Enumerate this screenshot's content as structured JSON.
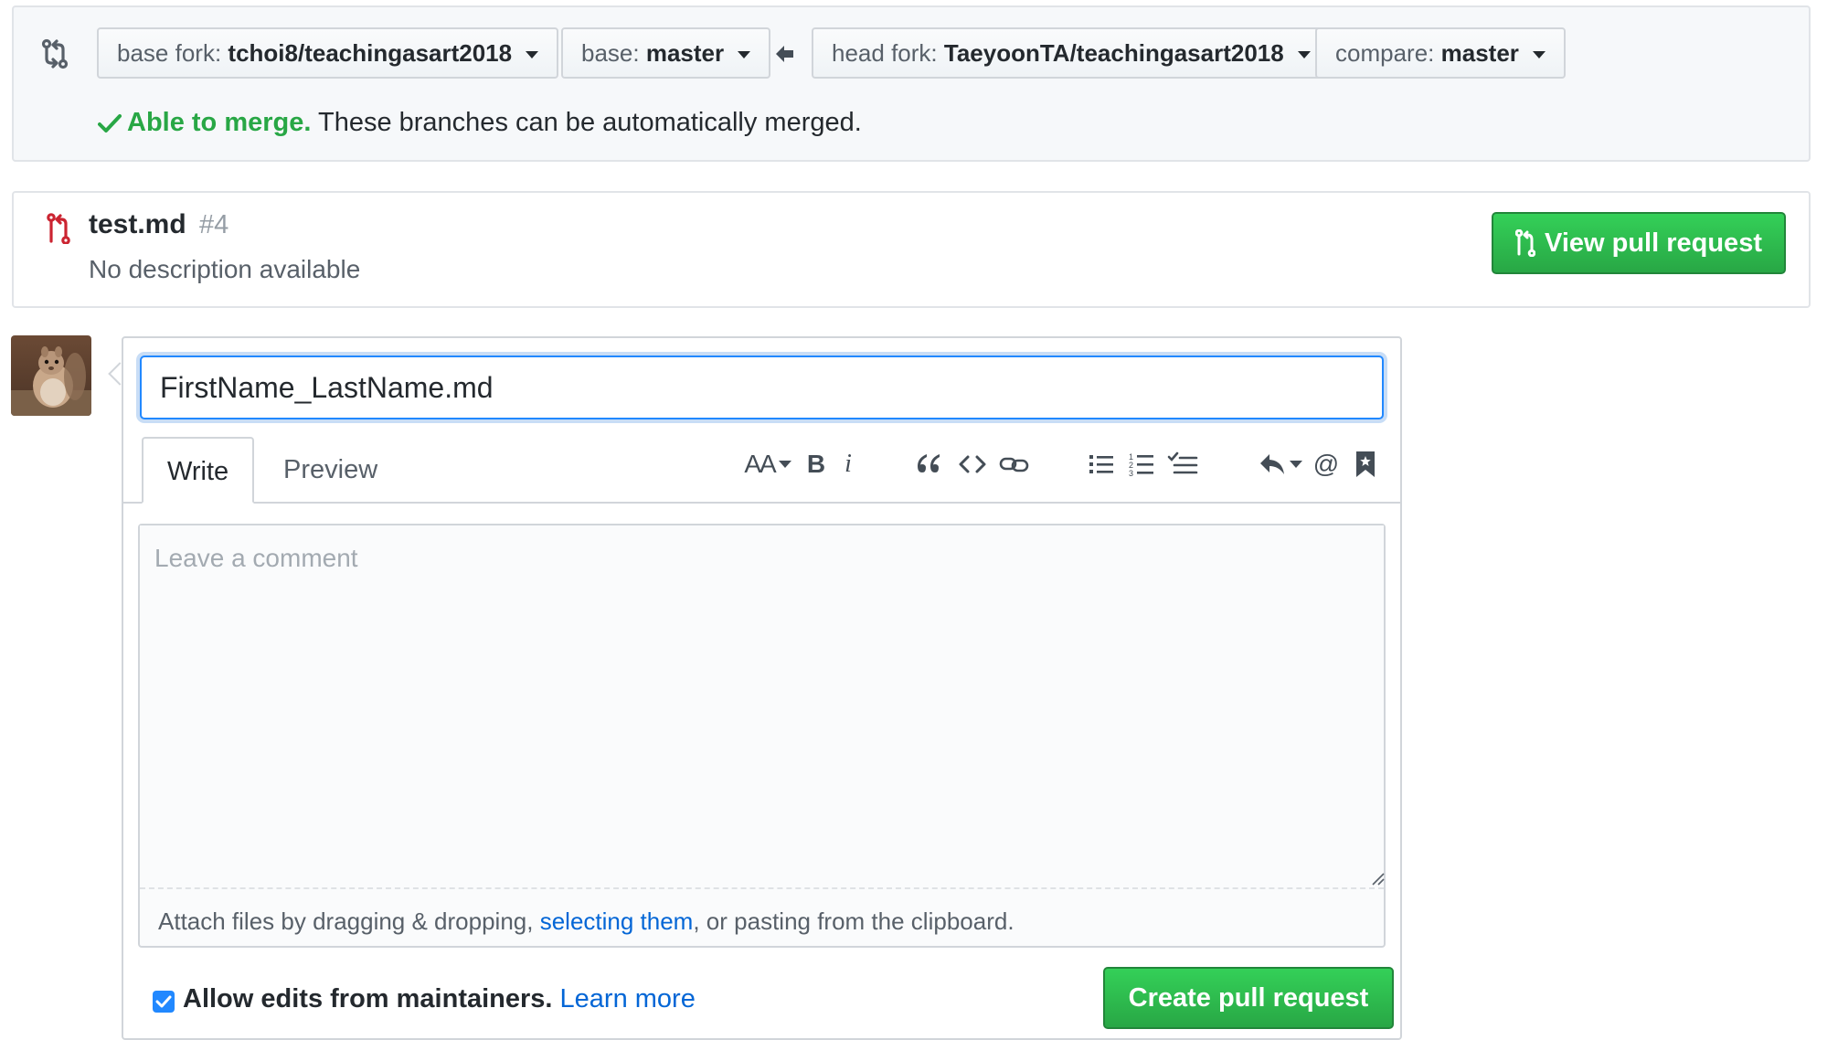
{
  "compare": {
    "base_fork_label": "base fork:",
    "base_fork_value": "tchoi8/teachingasart2018",
    "base_label": "base:",
    "base_value": "master",
    "head_fork_label": "head fork:",
    "head_fork_value": "TaeyoonTA/teachingasart2018",
    "compare_label": "compare:",
    "compare_value": "master",
    "merge_ok": "Able to merge.",
    "merge_text": "These branches can be automatically merged."
  },
  "existing_pr": {
    "title": "test.md",
    "number": "#4",
    "description": "No description available",
    "view_button": "View pull request"
  },
  "form": {
    "title_value": "FirstName_LastName.md",
    "tabs": [
      "Write",
      "Preview"
    ],
    "toolbar": {
      "header": "AA",
      "bold": "B",
      "italic": "i",
      "mention": "@"
    },
    "comment_placeholder": "Leave a comment",
    "attach_prefix": "Attach files by dragging & dropping, ",
    "attach_link": "selecting them",
    "attach_suffix": ", or pasting from the clipboard.",
    "maintainers_label": "Allow edits from maintainers.",
    "maintainers_checked": true,
    "learn_more": "Learn more",
    "create_button": "Create pull request"
  },
  "colors": {
    "accent_blue": "#0366d6",
    "success_green": "#28a745",
    "closed_red": "#cb2431"
  }
}
